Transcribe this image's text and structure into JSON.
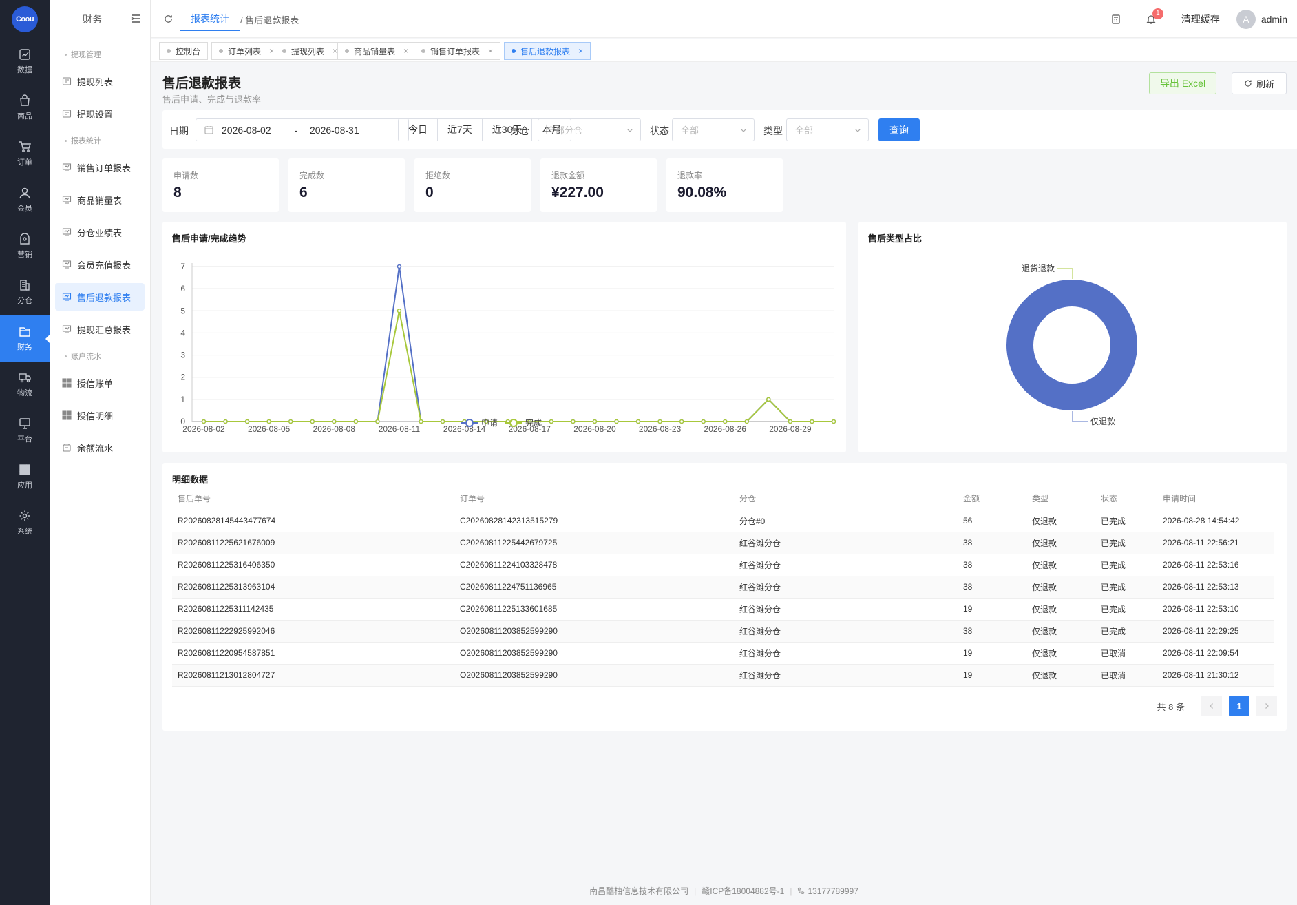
{
  "logo_text": "Coou",
  "rail": [
    {
      "label": "数据",
      "icon": "chart-icon"
    },
    {
      "label": "商品",
      "icon": "bag-icon"
    },
    {
      "label": "订单",
      "icon": "cart-icon"
    },
    {
      "label": "会员",
      "icon": "user-icon"
    },
    {
      "label": "营销",
      "icon": "marketing-icon"
    },
    {
      "label": "分仓",
      "icon": "building-icon"
    },
    {
      "label": "财务",
      "icon": "wallet-icon",
      "active": true
    },
    {
      "label": "物流",
      "icon": "truck-icon"
    },
    {
      "label": "平台",
      "icon": "monitor-icon"
    },
    {
      "label": "应用",
      "icon": "apps-icon"
    },
    {
      "label": "系统",
      "icon": "gear-icon"
    }
  ],
  "sidebar": {
    "title": "财务",
    "groups": [
      {
        "label": "提现管理",
        "items": [
          {
            "label": "提现列表"
          },
          {
            "label": "提现设置"
          }
        ]
      },
      {
        "label": "报表统计",
        "items": [
          {
            "label": "销售订单报表"
          },
          {
            "label": "商品销量表"
          },
          {
            "label": "分仓业绩表"
          },
          {
            "label": "会员充值报表"
          },
          {
            "label": "售后退款报表",
            "active": true
          },
          {
            "label": "提现汇总报表"
          }
        ]
      },
      {
        "label": "账户流水",
        "items": [
          {
            "label": "授信账单"
          },
          {
            "label": "授信明细"
          },
          {
            "label": "余额流水"
          }
        ]
      }
    ]
  },
  "header": {
    "breadcrumb_active": "报表统计",
    "breadcrumb_current": "/ 售后退款报表",
    "notification_count": "1",
    "clear_cache": "清理缓存",
    "avatar_initial": "A",
    "username": "admin"
  },
  "tabs": [
    {
      "label": "控制台",
      "closable": false
    },
    {
      "label": "订单列表",
      "closable": true
    },
    {
      "label": "提现列表",
      "closable": true
    },
    {
      "label": "商品销量表",
      "closable": true
    },
    {
      "label": "销售订单报表",
      "closable": true
    },
    {
      "label": "售后退款报表",
      "closable": true,
      "active": true
    }
  ],
  "page": {
    "title": "售后退款报表",
    "subtitle": "售后申请、完成与退款率",
    "export_label": "导出 Excel",
    "refresh_label": "刷新"
  },
  "filters": {
    "date_label": "日期",
    "date_start": "2026-08-02",
    "date_sep": "-",
    "date_end": "2026-08-31",
    "quick": [
      "今日",
      "近7天",
      "近30天",
      "本月"
    ],
    "warehouse_label": "分仓",
    "warehouse_value": "全部分仓",
    "status_label": "状态",
    "status_value": "全部",
    "type_label": "类型",
    "type_value": "全部",
    "query_label": "查询"
  },
  "kpis": [
    {
      "label": "申请数",
      "value": "8"
    },
    {
      "label": "完成数",
      "value": "6"
    },
    {
      "label": "拒绝数",
      "value": "0"
    },
    {
      "label": "退款金额",
      "value": "¥227.00"
    },
    {
      "label": "退款率",
      "value": "90.08%"
    }
  ],
  "trend_card_title": "售后申请/完成趋势",
  "pie_card_title": "售后类型占比",
  "chart_data": [
    {
      "type": "line",
      "title": "售后申请/完成趋势",
      "x": [
        "2026-08-02",
        "2026-08-03",
        "2026-08-04",
        "2026-08-05",
        "2026-08-06",
        "2026-08-07",
        "2026-08-08",
        "2026-08-09",
        "2026-08-10",
        "2026-08-11",
        "2026-08-12",
        "2026-08-13",
        "2026-08-14",
        "2026-08-15",
        "2026-08-16",
        "2026-08-17",
        "2026-08-18",
        "2026-08-19",
        "2026-08-20",
        "2026-08-21",
        "2026-08-22",
        "2026-08-23",
        "2026-08-24",
        "2026-08-25",
        "2026-08-26",
        "2026-08-27",
        "2026-08-28",
        "2026-08-29",
        "2026-08-30",
        "2026-08-31"
      ],
      "x_tick_labels": [
        "2026-08-02",
        "2026-08-05",
        "2026-08-08",
        "2026-08-11",
        "2026-08-14",
        "2026-08-17",
        "2026-08-20",
        "2026-08-23",
        "2026-08-26",
        "2026-08-29"
      ],
      "y_ticks": [
        0,
        1,
        2,
        3,
        4,
        5,
        6,
        7
      ],
      "ylim": [
        0,
        7
      ],
      "grid": true,
      "legend_position": "bottom-center",
      "series": [
        {
          "name": "申请",
          "color": "#5470c6",
          "values": [
            0,
            0,
            0,
            0,
            0,
            0,
            0,
            0,
            0,
            7,
            0,
            0,
            0,
            0,
            0,
            0,
            0,
            0,
            0,
            0,
            0,
            0,
            0,
            0,
            0,
            0,
            1,
            0,
            0,
            0
          ]
        },
        {
          "name": "完成",
          "color": "#a8c83c",
          "values": [
            0,
            0,
            0,
            0,
            0,
            0,
            0,
            0,
            0,
            5,
            0,
            0,
            0,
            0,
            0,
            0,
            0,
            0,
            0,
            0,
            0,
            0,
            0,
            0,
            0,
            0,
            1,
            0,
            0,
            0
          ]
        }
      ]
    },
    {
      "type": "pie",
      "title": "售后类型占比",
      "donut": true,
      "slices": [
        {
          "label": "仅退款",
          "value": 8,
          "color": "#5470c6"
        },
        {
          "label": "退货退款",
          "value": 0,
          "color": "#a8c83c"
        }
      ]
    }
  ],
  "table": {
    "title": "明细数据",
    "columns": [
      "售后单号",
      "订单号",
      "分仓",
      "金额",
      "类型",
      "状态",
      "申请时间"
    ],
    "rows": [
      [
        "R20260828145443477674",
        "C20260828142313515279",
        "分仓#0",
        "56",
        "仅退款",
        "已完成",
        "2026-08-28 14:54:42"
      ],
      [
        "R20260811225621676009",
        "C20260811225442679725",
        "红谷滩分仓",
        "38",
        "仅退款",
        "已完成",
        "2026-08-11 22:56:21"
      ],
      [
        "R20260811225316406350",
        "C20260811224103328478",
        "红谷滩分仓",
        "38",
        "仅退款",
        "已完成",
        "2026-08-11 22:53:16"
      ],
      [
        "R20260811225313963104",
        "C20260811224751136965",
        "红谷滩分仓",
        "38",
        "仅退款",
        "已完成",
        "2026-08-11 22:53:13"
      ],
      [
        "R20260811225311142435",
        "C20260811225133601685",
        "红谷滩分仓",
        "19",
        "仅退款",
        "已完成",
        "2026-08-11 22:53:10"
      ],
      [
        "R20260811222925992046",
        "O20260811203852599290",
        "红谷滩分仓",
        "38",
        "仅退款",
        "已完成",
        "2026-08-11 22:29:25"
      ],
      [
        "R20260811220954587851",
        "O20260811203852599290",
        "红谷滩分仓",
        "19",
        "仅退款",
        "已取消",
        "2026-08-11 22:09:54"
      ],
      [
        "R20260811213012804727",
        "O20260811203852599290",
        "红谷滩分仓",
        "19",
        "仅退款",
        "已取消",
        "2026-08-11 21:30:12"
      ]
    ],
    "total": "共 8 条",
    "current_page": "1"
  },
  "footer": {
    "company": "南昌酷柚信息技术有限公司",
    "icp": "赣ICP备18004882号-1",
    "phone": "13177789997"
  }
}
